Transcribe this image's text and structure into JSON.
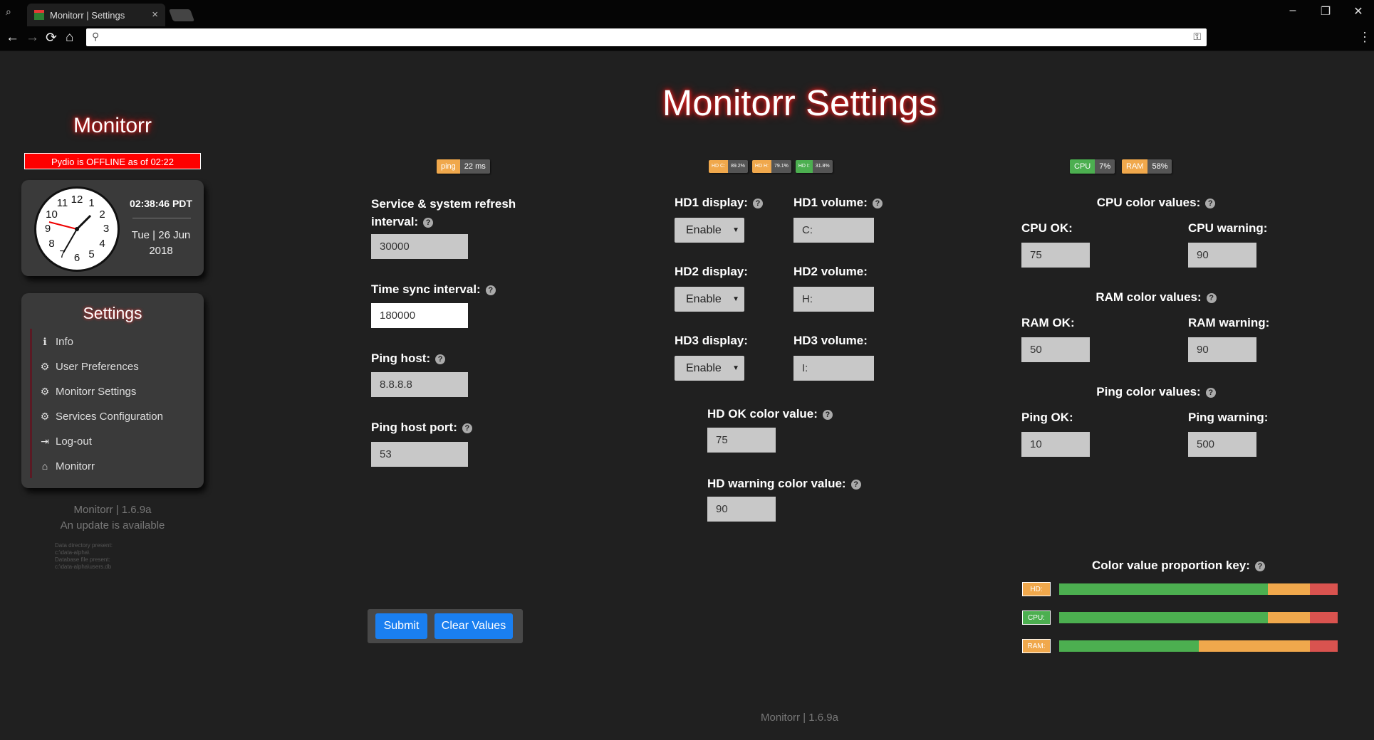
{
  "browser": {
    "tab_title": "Monitorr | Settings",
    "close": "×",
    "window": {
      "minimize": "–",
      "restore": "❐",
      "close": "✕"
    },
    "nav": {
      "back": "←",
      "forward": "→",
      "reload": "⟳",
      "home": "⌂"
    },
    "menu": "⋮"
  },
  "sidebar": {
    "title": "Monitorr",
    "offline_banner": "Pydio is OFFLINE as of 02:22",
    "clock": {
      "time": "02:38:46 PDT",
      "date": "Tue | 26 Jun 2018",
      "numbers": [
        "12",
        "1",
        "2",
        "3",
        "4",
        "5",
        "6",
        "7",
        "8",
        "9",
        "10",
        "11"
      ]
    },
    "settings_title": "Settings",
    "items": [
      {
        "icon": "ℹ",
        "label": "Info"
      },
      {
        "icon": "⚙",
        "label": "User Preferences"
      },
      {
        "icon": "⚙",
        "label": "Monitorr Settings"
      },
      {
        "icon": "⚙",
        "label": "Services Configuration"
      },
      {
        "icon": "⇥",
        "label": "Log-out"
      },
      {
        "icon": "⌂",
        "label": "Monitorr"
      }
    ],
    "version": "Monitorr | 1.6.9a",
    "update": "An update is available",
    "tiny": [
      "Data directory present:",
      "c:\\data-alpha\\",
      "Database file present:",
      "c:\\data-alpha\\users.db"
    ]
  },
  "page_title": "Monitorr Settings",
  "badges": {
    "ping": {
      "label": "ping",
      "value": "22 ms",
      "color": "#f0a84c"
    },
    "hd": [
      {
        "label": "HD C:",
        "value": "89.2%",
        "color": "#f0a84c"
      },
      {
        "label": "HD H:",
        "value": "79.1%",
        "color": "#f0a84c"
      },
      {
        "label": "HD I:",
        "value": "31.8%",
        "color": "#4caf50"
      }
    ],
    "cpu": {
      "label": "CPU",
      "value": "7%",
      "color": "#4caf50"
    },
    "ram": {
      "label": "RAM",
      "value": "58%",
      "color": "#f0a84c"
    }
  },
  "help": "?",
  "left_form": {
    "refresh": {
      "label": "Service & system refresh interval:",
      "value": "30000"
    },
    "timesync": {
      "label": "Time sync interval:",
      "value": "180000"
    },
    "pinghost": {
      "label": "Ping host:",
      "value": "8.8.8.8"
    },
    "pingport": {
      "label": "Ping host port:",
      "value": "53"
    }
  },
  "buttons": {
    "submit": "Submit",
    "clear": "Clear Values"
  },
  "hd_form": {
    "rows": [
      {
        "display_label": "HD1 display:",
        "display_value": "Enable",
        "volume_label": "HD1 volume:",
        "volume_value": "C:"
      },
      {
        "display_label": "HD2 display:",
        "display_value": "Enable",
        "volume_label": "HD2 volume:",
        "volume_value": "H:"
      },
      {
        "display_label": "HD3 display:",
        "display_value": "Enable",
        "volume_label": "HD3 volume:",
        "volume_value": "I:"
      }
    ],
    "ok": {
      "label": "HD OK color value:",
      "value": "75"
    },
    "warning": {
      "label": "HD warning color value:",
      "value": "90"
    }
  },
  "color_form": {
    "cpu": {
      "title": "CPU color values:",
      "ok_label": "CPU OK:",
      "ok": "75",
      "warn_label": "CPU warning:",
      "warn": "90"
    },
    "ram": {
      "title": "RAM color values:",
      "ok_label": "RAM OK:",
      "ok": "50",
      "warn_label": "RAM warning:",
      "warn": "90"
    },
    "ping": {
      "title": "Ping color values:",
      "ok_label": "Ping OK:",
      "ok": "10",
      "warn_label": "Ping warning:",
      "warn": "500"
    }
  },
  "key": {
    "title": "Color value proportion key:",
    "rows": [
      {
        "label": "HD:",
        "color": "#f0a84c",
        "ok": 75,
        "warn": 90
      },
      {
        "label": "CPU:",
        "color": "#4caf50",
        "ok": 75,
        "warn": 90
      },
      {
        "label": "RAM:",
        "color": "#f0a84c",
        "ok": 50,
        "warn": 90
      }
    ],
    "colors": {
      "ok": "#4caf50",
      "warn": "#f0a84c",
      "bad": "#d9534f"
    }
  },
  "footer": "Monitorr | 1.6.9a"
}
